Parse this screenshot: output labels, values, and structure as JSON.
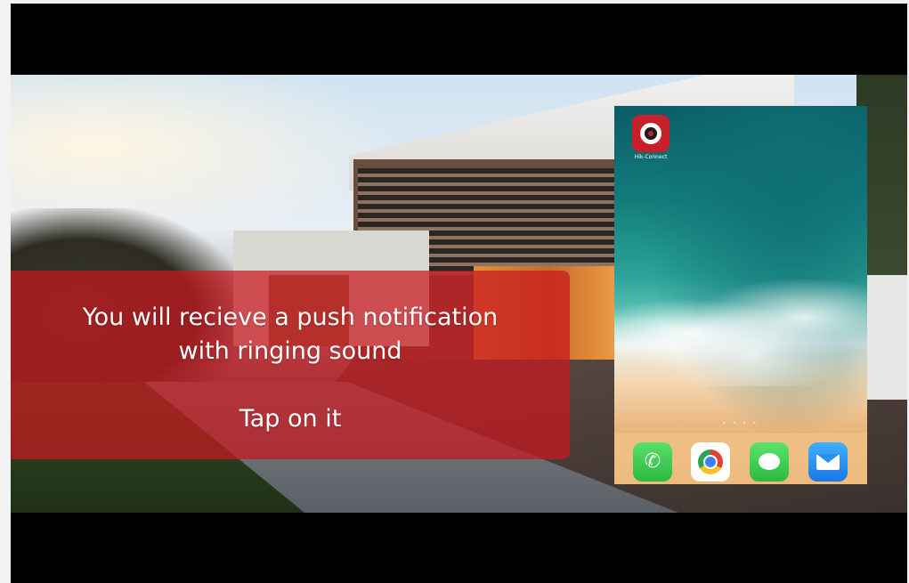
{
  "caption": {
    "line1": "You will recieve a push notification",
    "line2": "with ringing sound",
    "line3": "Tap on it"
  },
  "phone": {
    "app": {
      "label": "Hik-Connect",
      "icon": "hik-connect-icon"
    },
    "page_indicator": "• • • •",
    "dock": [
      {
        "name": "phone-icon",
        "glyph": "✆"
      },
      {
        "name": "chrome-icon"
      },
      {
        "name": "messages-icon"
      },
      {
        "name": "mail-icon"
      }
    ]
  },
  "colors": {
    "caption_overlay": "#c8181e",
    "letterbox": "#000000",
    "app_icon_red": "#c8202a"
  }
}
